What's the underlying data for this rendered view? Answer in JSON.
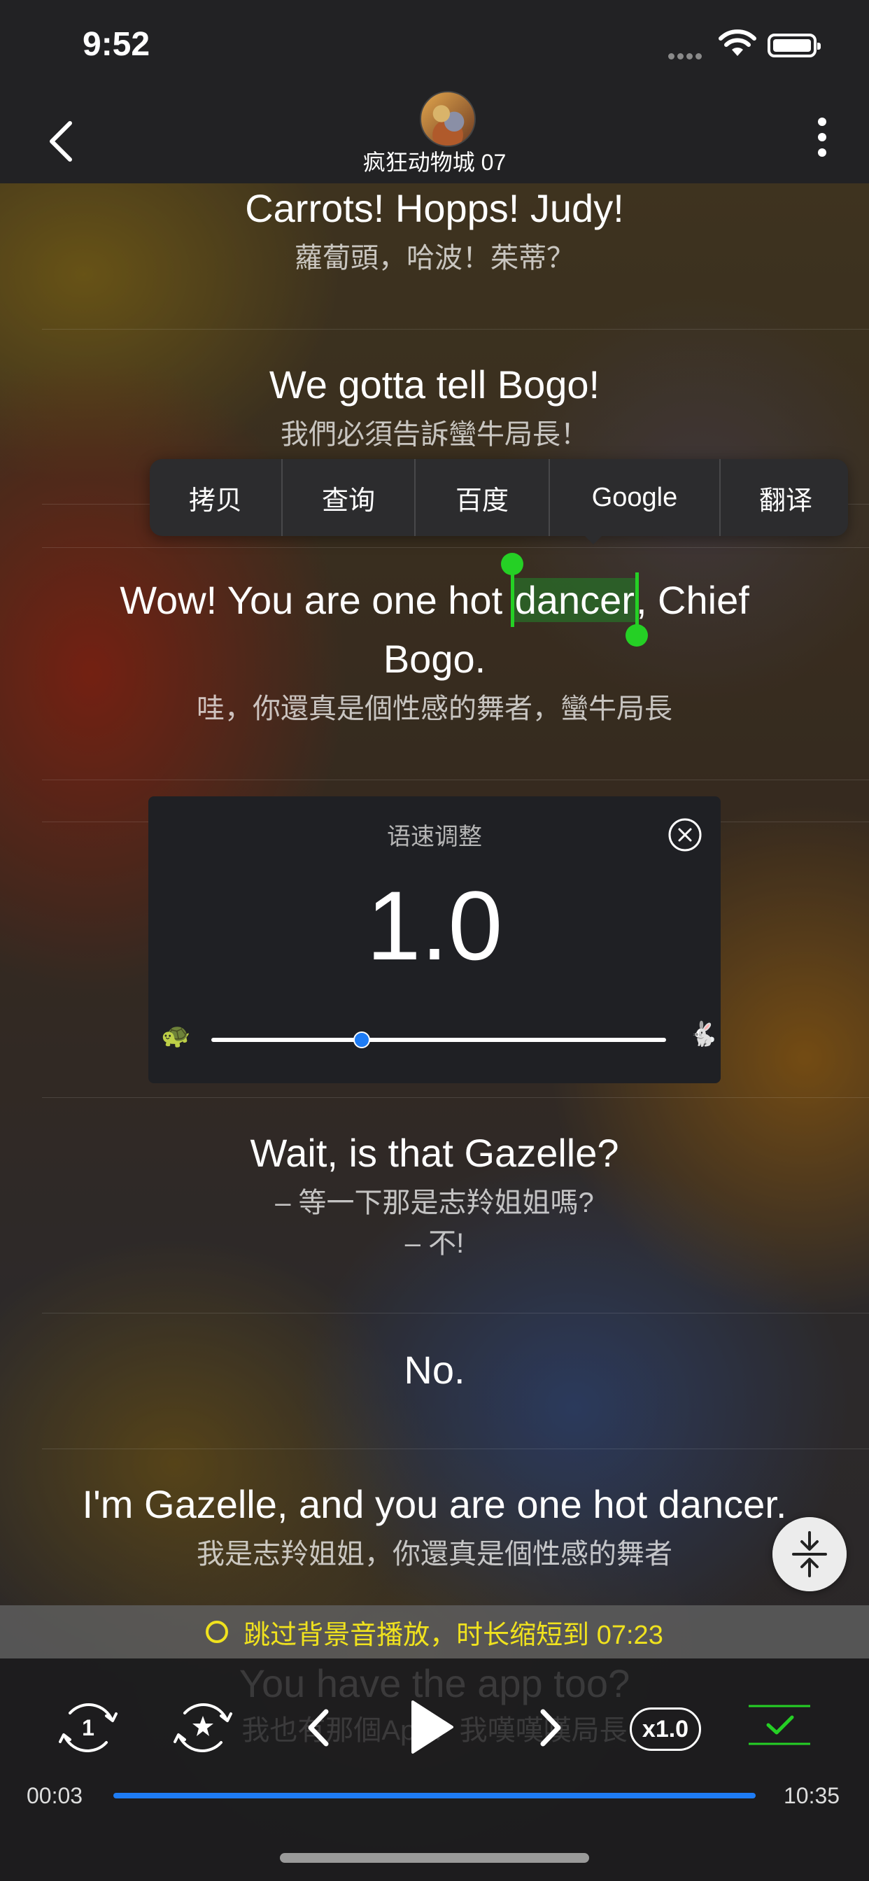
{
  "status_bar": {
    "time": "9:52"
  },
  "nav": {
    "title": "疯狂动物城 07"
  },
  "subtitles": [
    {
      "en": "Carrots! Hopps! Judy!",
      "zh": "蘿蔔頭，哈波！茱蒂？"
    },
    {
      "en": "We gotta tell Bogo!",
      "zh": "我們必須告訴蠻牛局長！"
    },
    {
      "en_before": "Wow! You are one hot ",
      "en_selected": "dancer",
      "en_after": ", Chief",
      "en_line2": "Bogo.",
      "zh": "哇，你還真是個性感的舞者，蠻牛局長"
    },
    {
      "en": "Wait, is that Gazelle?",
      "zh": "– 等一下那是志羚姐姐嗎?",
      "zh_line2": "– 不!"
    },
    {
      "en": "No."
    },
    {
      "en": "I'm Gazelle, and you are one hot dancer.",
      "zh": "我是志羚姐姐，你還真是個性感的舞者"
    },
    {
      "en": "You have the app too?",
      "zh": "我也有那個App？我嘆嘆嘆局長"
    }
  ],
  "context_menu": {
    "items": [
      "拷贝",
      "查询",
      "百度",
      "Google",
      "翻译"
    ]
  },
  "speed_panel": {
    "title": "语速调整",
    "value": "1.0",
    "slider_fraction": 0.33,
    "slow_icon": "turtle-icon",
    "fast_icon": "rabbit-icon"
  },
  "notice": {
    "text": "跳过背景音播放，时长缩短到 07:23"
  },
  "player": {
    "repeat_one_label": "1",
    "speed_label": "x1.0",
    "current_time": "00:03",
    "total_time": "10:35",
    "progress_fraction": 1.0
  },
  "colors": {
    "accent_green": "#25d025",
    "progress_blue": "#1e7cf5",
    "notice_yellow": "#f0e21e"
  }
}
